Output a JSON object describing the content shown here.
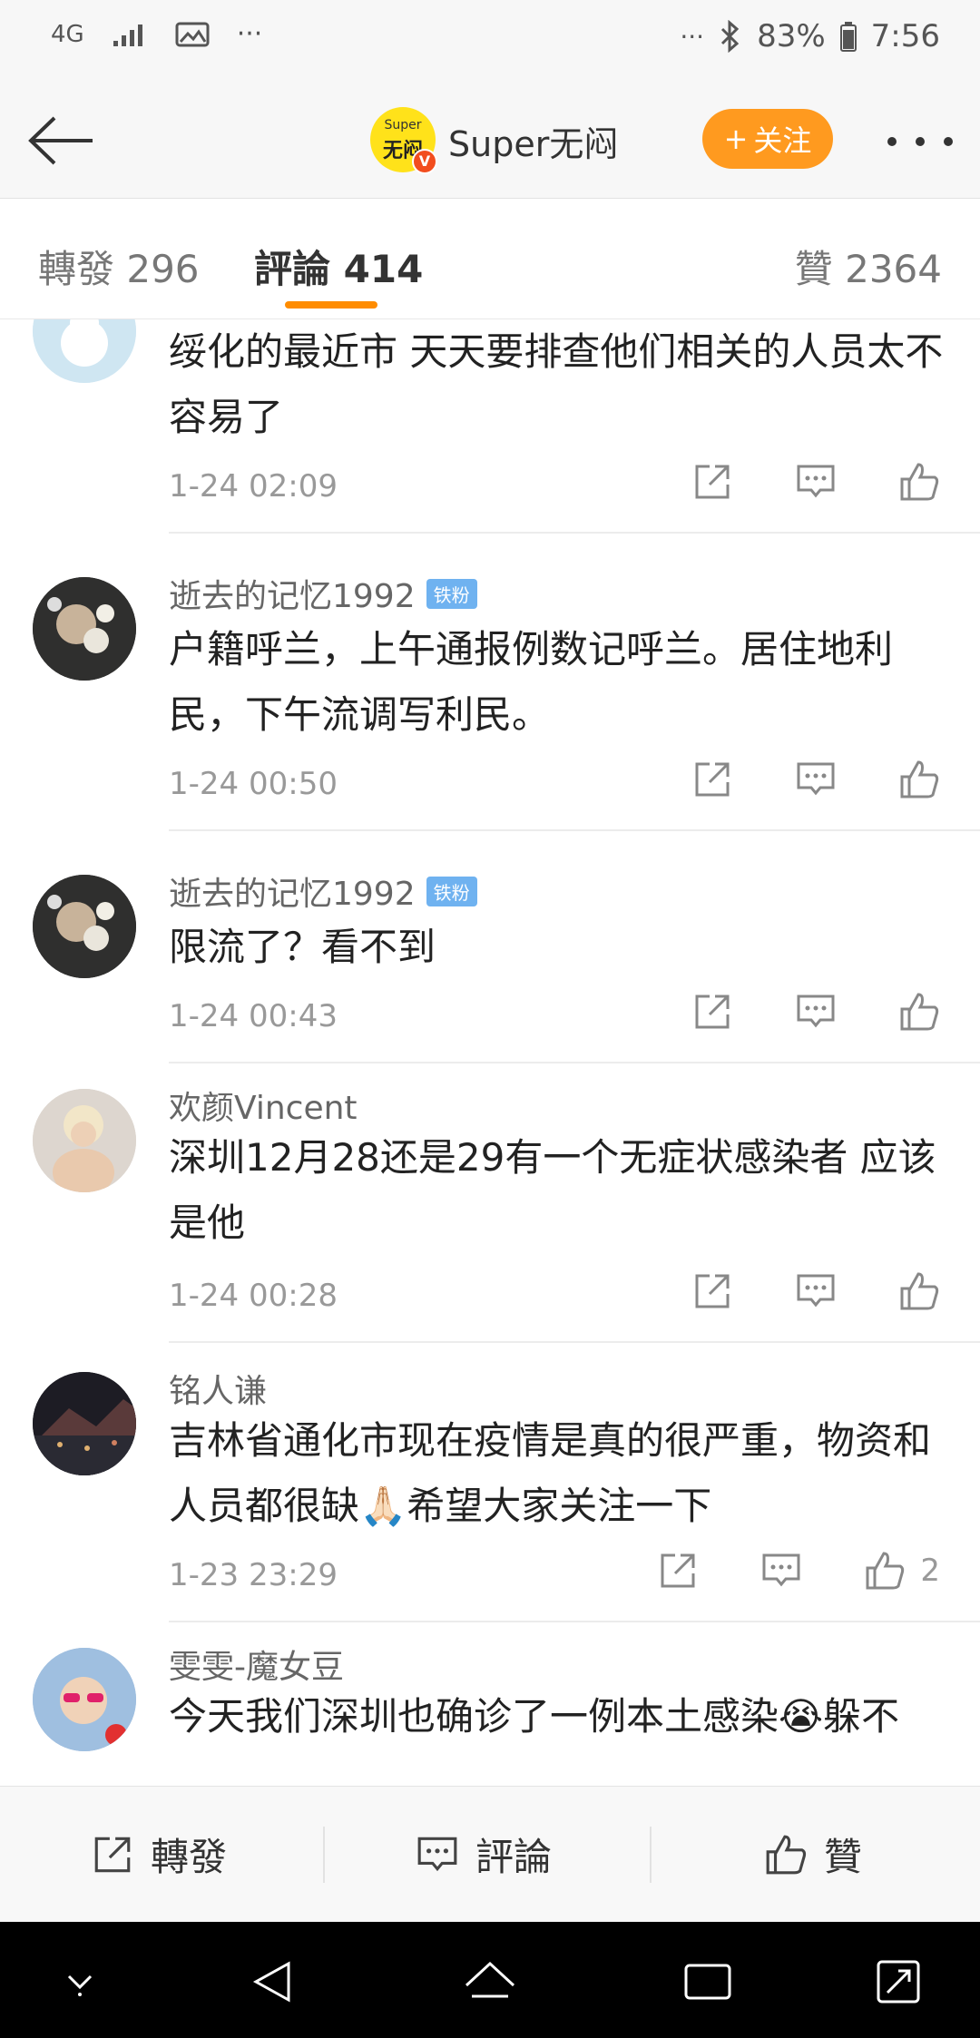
{
  "status_bar": {
    "network": "4G",
    "dots_left": "···",
    "dots_right": "···",
    "battery": "83%",
    "time": "7:56"
  },
  "nav": {
    "logo_top": "Super",
    "logo_bottom": "无闷",
    "verified": "V",
    "title": "Super无闷",
    "follow_label": "关注",
    "follow_plus": "+"
  },
  "tabs": [
    {
      "label": "轉發 296"
    },
    {
      "label": "評論 414"
    },
    {
      "label": "贊 2364"
    }
  ],
  "comments": [
    {
      "user": "",
      "badge": "",
      "text": "绥化的最近市 天天要排查他们相关的人员太不容易了",
      "time": "1-24 02:09",
      "likes": ""
    },
    {
      "user": "逝去的记忆1992",
      "badge": "铁粉",
      "text": "户籍呼兰，上午通报例数记呼兰。居住地利民，下午流调写利民。",
      "time": "1-24 00:50",
      "likes": ""
    },
    {
      "user": "逝去的记忆1992",
      "badge": "铁粉",
      "text": "限流了？看不到",
      "time": "1-24 00:43",
      "likes": ""
    },
    {
      "user": "欢颜Vincent",
      "badge": "",
      "text": "深圳12月28还是29有一个无症状感染者 应该是他",
      "time": "1-24 00:28",
      "likes": ""
    },
    {
      "user": "铭人谦",
      "badge": "",
      "text": "吉林省通化市现在疫情是真的很严重，物资和人员都很缺🙏🏻希望大家关注一下",
      "time": "1-23 23:29",
      "likes": "2"
    },
    {
      "user": "雯雯-魔女豆",
      "badge": "",
      "text": "今天我们深圳也确诊了一例本土感染😭躲不",
      "time": "",
      "likes": ""
    }
  ],
  "bottom_bar": {
    "repost": "轉發",
    "comment": "評論",
    "like": "贊"
  },
  "colors": {
    "accent": "#ff9a1f",
    "tab_indicator": "#ff8c00",
    "fan_badge": "#6fb2f0"
  }
}
